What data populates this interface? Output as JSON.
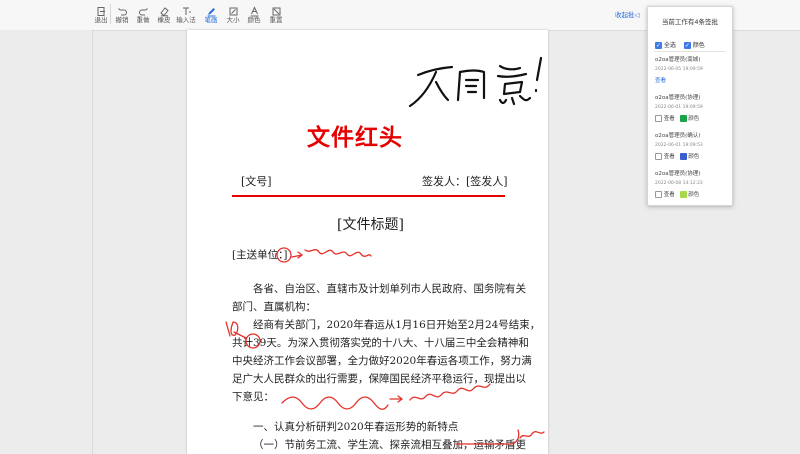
{
  "toolbar": {
    "items": [
      {
        "label": "退出",
        "icon": "exit-icon"
      },
      {
        "label": "撤销",
        "icon": "undo-icon"
      },
      {
        "label": "重做",
        "icon": "redo-icon"
      },
      {
        "label": "橡皮",
        "icon": "eraser-icon"
      },
      {
        "label": "输入法",
        "icon": "text-input-icon"
      },
      {
        "label": "笔画",
        "icon": "pen-icon"
      },
      {
        "label": "大小",
        "icon": "size-icon"
      },
      {
        "label": "颜色",
        "icon": "color-icon"
      },
      {
        "label": "重置",
        "icon": "reset-icon"
      }
    ],
    "active": "笔画"
  },
  "header_link": "收起批",
  "document": {
    "red_header": "文件红头",
    "doc_number": "[文号]",
    "signer": "签发人：[签发人]",
    "doc_title": "[文件标题]",
    "recipient": "[主送单位：]",
    "paragraph1_line1": "各省、自治区、直辖市及计划单列市人民政府、国务院有关",
    "paragraph1_line2": "部门、直属机构：",
    "paragraph2_line1": "经商有关部门，2020年春运从1月16日开始至2月24号结束，",
    "paragraph2_line2": "共计39天。为深入贯彻落实党的十八大、十八届三中全会精神和",
    "paragraph2_line3": "中央经济工作会议部署，全力做好2020年春运各项工作，努力满",
    "paragraph2_line4": "足广大人民群众的出行需要，保障国民经济平稳运行，现提出以",
    "paragraph2_line5": "下意见：",
    "section1": "一、认真分析研判2020年春运形势的新特点",
    "section1_sub": "（一）节前务工流、学生流、探亲流相互叠加，运输矛盾更"
  },
  "annotations": {
    "top_handwriting": "不同意！",
    "note_recipient": "这里写一封",
    "note_days": "40",
    "note_paragraph": "这里多写一行",
    "note_strike": "去掉"
  },
  "panel": {
    "title": "当前工作有4条签批",
    "select_all": "全选",
    "color_all": "颜色",
    "entries": [
      {
        "name": "o2oa管理员(南城)",
        "time": "2022-06-05 19:09:59",
        "action": "查看"
      },
      {
        "name": "o2oa管理员(协理)",
        "time": "2022-06-01 19:09:59",
        "view": "查看",
        "color": "颜色",
        "swatch": "#1aa34a"
      },
      {
        "name": "o2oa管理员(确认)",
        "time": "2022-06-01 19:09:53",
        "view": "查看",
        "color": "颜色",
        "swatch": "#3a5fd0"
      },
      {
        "name": "o2oa管理员(协理)",
        "time": "2022-06-08 14:12:23",
        "view": "查看",
        "color": "颜色",
        "swatch": "#a8d84a"
      }
    ]
  },
  "colors": {
    "accent": "#2a6fdb",
    "red_header": "#e60000",
    "annotation_red": "#e4322b",
    "ink": "#111111"
  }
}
